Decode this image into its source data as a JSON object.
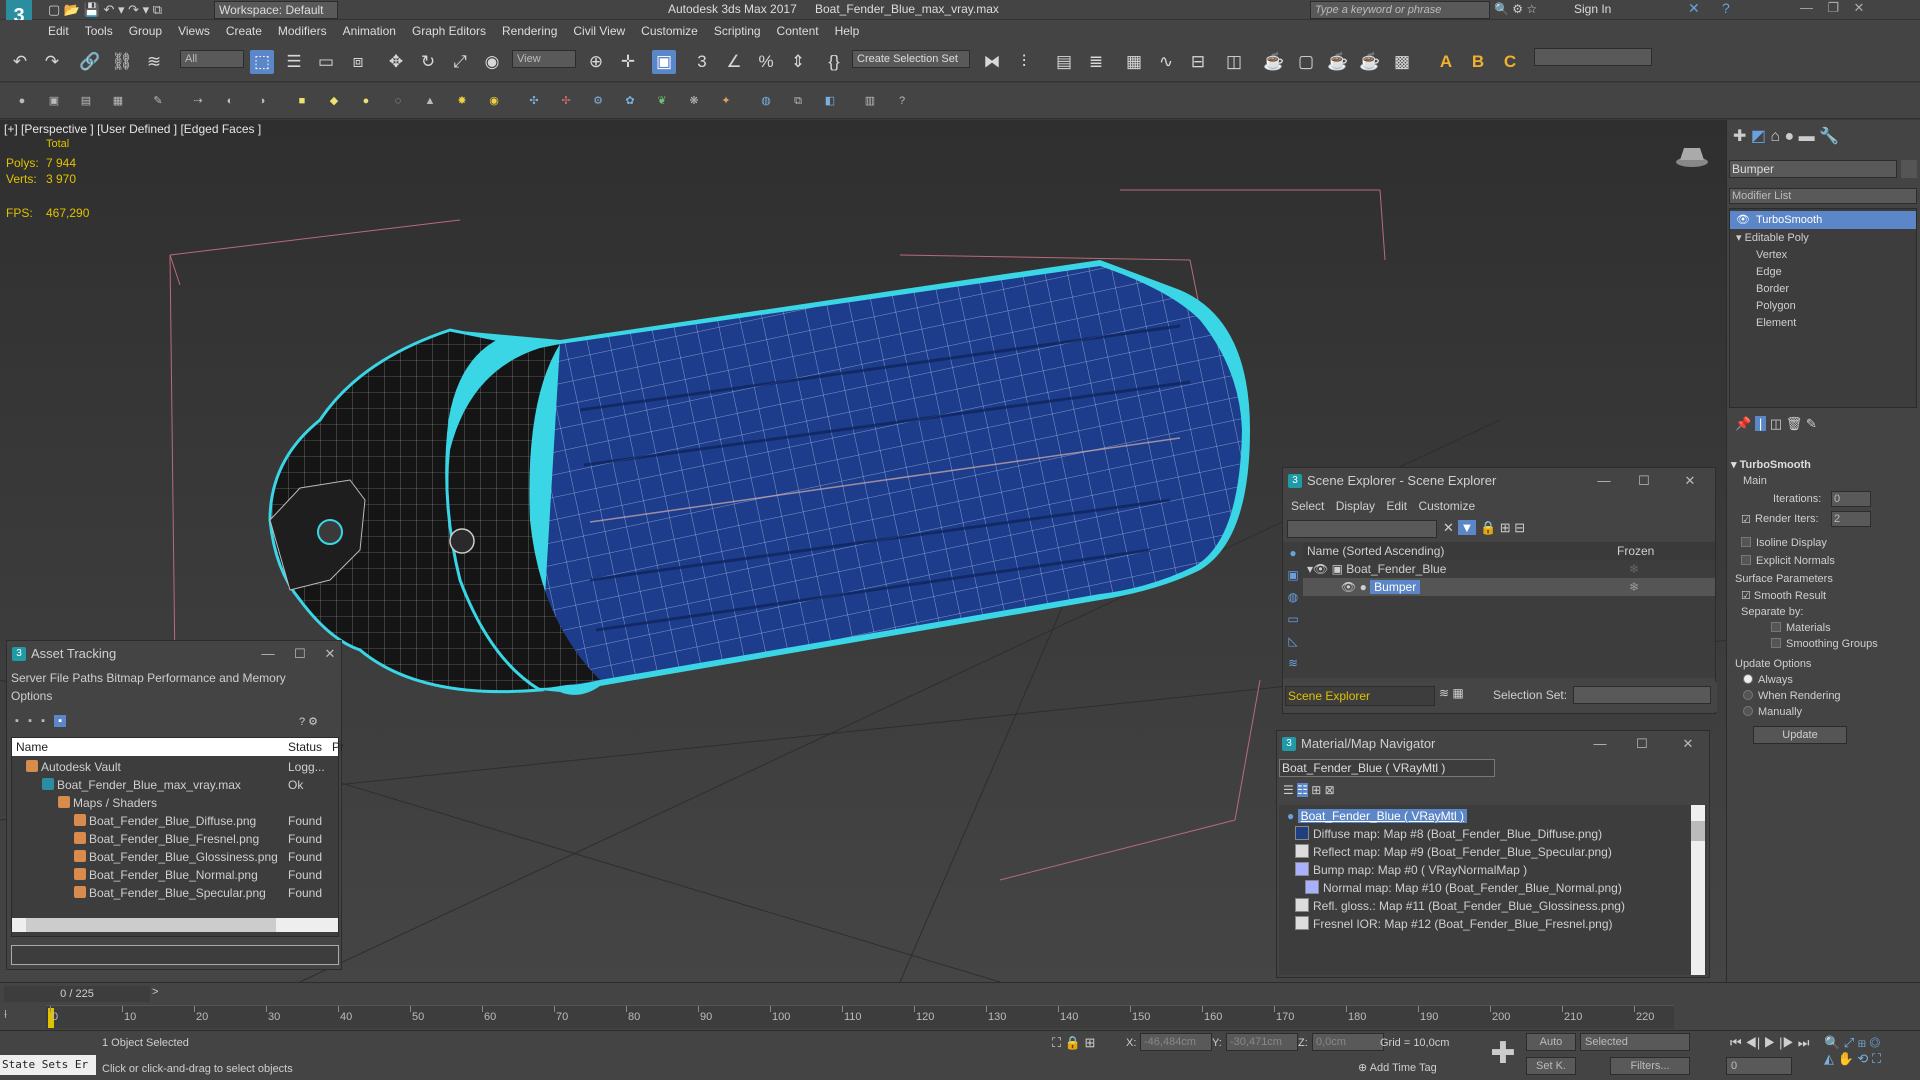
{
  "titlebar": {
    "workspace_label": "Workspace: Default",
    "app_title": "Autodesk 3ds Max 2017",
    "file_title": "Boat_Fender_Blue_max_vray.max",
    "search_placeholder": "Type a keyword or phrase",
    "sign_in": "Sign In"
  },
  "menu": [
    "Edit",
    "Tools",
    "Group",
    "Views",
    "Create",
    "Modifiers",
    "Animation",
    "Graph Editors",
    "Rendering",
    "Civil View",
    "Customize",
    "Scripting",
    "Content",
    "Help"
  ],
  "toolbar": {
    "filter_select": "All",
    "view_select": "View",
    "selection_set": "Create Selection Set"
  },
  "viewport": {
    "label_plus": "[+]",
    "label_view": "[Perspective ]",
    "label_shading": "[User Defined ]",
    "label_mode": "[Edged Faces ]",
    "stats_total": "Total",
    "polys_label": "Polys:",
    "polys_value": "7 944",
    "verts_label": "Verts:",
    "verts_value": "3 970",
    "fps_label": "FPS:",
    "fps_value": "467,290"
  },
  "asset_tracking": {
    "title": "Asset Tracking",
    "menu": [
      "Server",
      "File",
      "Paths",
      "Bitmap Performance and Memory"
    ],
    "menu2": "Options",
    "col_name": "Name",
    "col_status": "Status",
    "col_pr": "Pr",
    "rows": [
      {
        "name": "Autodesk Vault",
        "status": "Logg..."
      },
      {
        "name": "Boat_Fender_Blue_max_vray.max",
        "status": "Ok"
      },
      {
        "name": "Maps / Shaders",
        "status": ""
      },
      {
        "name": "Boat_Fender_Blue_Diffuse.png",
        "status": "Found"
      },
      {
        "name": "Boat_Fender_Blue_Fresnel.png",
        "status": "Found"
      },
      {
        "name": "Boat_Fender_Blue_Glossiness.png",
        "status": "Found"
      },
      {
        "name": "Boat_Fender_Blue_Normal.png",
        "status": "Found"
      },
      {
        "name": "Boat_Fender_Blue_Specular.png",
        "status": "Found"
      }
    ]
  },
  "scene_explorer": {
    "title": "Scene Explorer - Scene Explorer",
    "menu": [
      "Select",
      "Display",
      "Edit",
      "Customize"
    ],
    "col_name": "Name (Sorted Ascending)",
    "col_frozen": "Frozen",
    "items": [
      "Boat_Fender_Blue",
      "Bumper"
    ],
    "footer_name": "Scene Explorer",
    "selection_set_label": "Selection Set:"
  },
  "material_nav": {
    "title": "Material/Map Navigator",
    "field": "Boat_Fender_Blue  ( VRayMtl )",
    "items": [
      "Boat_Fender_Blue  ( VRayMtl )",
      "Diffuse map: Map #8 (Boat_Fender_Blue_Diffuse.png)",
      "Reflect map: Map #9 (Boat_Fender_Blue_Specular.png)",
      "Bump map: Map #0  ( VRayNormalMap )",
      "Normal map: Map #10 (Boat_Fender_Blue_Normal.png)",
      "Refl. gloss.: Map #11 (Boat_Fender_Blue_Glossiness.png)",
      "Fresnel IOR: Map #12 (Boat_Fender_Blue_Fresnel.png)"
    ]
  },
  "command_panel": {
    "object_name": "Bumper",
    "modifier_list": "Modifier List",
    "stack": [
      "TurboSmooth",
      "Editable Poly",
      "Vertex",
      "Edge",
      "Border",
      "Polygon",
      "Element"
    ],
    "rollout_title": "TurboSmooth",
    "main_label": "Main",
    "iterations_label": "Iterations:",
    "iterations_value": "0",
    "render_iters_label": "Render Iters:",
    "render_iters_value": "2",
    "isoline": "Isoline Display",
    "explicit_normals": "Explicit Normals",
    "surface_params": "Surface Parameters",
    "smooth_result": "Smooth Result",
    "separate_by": "Separate by:",
    "materials": "Materials",
    "smoothing_groups": "Smoothing Groups",
    "update_options": "Update Options",
    "always": "Always",
    "when_rendering": "When Rendering",
    "manually": "Manually",
    "update_btn": "Update"
  },
  "timeline": {
    "frame_counter": "0 / 225",
    "ticks": [
      "0",
      "10",
      "20",
      "30",
      "40",
      "50",
      "60",
      "70",
      "80",
      "90",
      "100",
      "110",
      "120",
      "130",
      "140",
      "150",
      "160",
      "170",
      "180",
      "190",
      "200",
      "210",
      "220"
    ]
  },
  "status": {
    "state_sets": "State Sets Er",
    "selected_msg": "1 Object Selected",
    "hint": "Click or click-and-drag to select objects",
    "x_label": "X:",
    "x_value": "-46,484cm",
    "y_label": "Y:",
    "y_value": "-30,471cm",
    "z_label": "Z:",
    "z_value": "0,0cm",
    "grid": "Grid = 10,0cm",
    "add_time_tag": "Add Time Tag",
    "auto": "Auto",
    "selected": "Selected",
    "set_k": "Set K.",
    "filters": "Filters...",
    "frame": "0"
  },
  "colors": {
    "accent": "#5b86c8",
    "selection_cyan": "#3ad6e6",
    "fender_blue": "#1a3b8a",
    "stat_yellow": "#e0c200"
  }
}
